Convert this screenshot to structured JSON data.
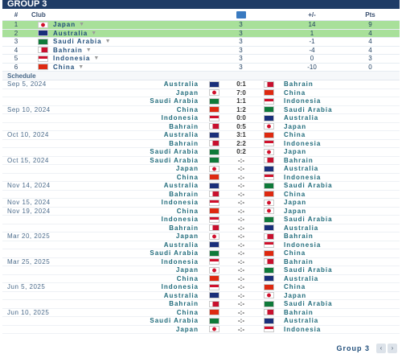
{
  "header": {
    "title": "GROUP 3"
  },
  "standings": {
    "columns": {
      "pos": "#",
      "club": "Club",
      "gd": "+/-",
      "pts": "Pts"
    },
    "rows": [
      {
        "pos": "1",
        "club": "Japan",
        "flag": "japan",
        "played": "3",
        "gd": "14",
        "pts": "9",
        "qualified": true
      },
      {
        "pos": "2",
        "club": "Australia",
        "flag": "australia",
        "played": "3",
        "gd": "1",
        "pts": "4",
        "qualified": true
      },
      {
        "pos": "3",
        "club": "Saudi Arabia",
        "flag": "saudi",
        "played": "3",
        "gd": "-1",
        "pts": "4",
        "qualified": false
      },
      {
        "pos": "4",
        "club": "Bahrain",
        "flag": "bahrain",
        "played": "3",
        "gd": "-4",
        "pts": "4",
        "qualified": false
      },
      {
        "pos": "5",
        "club": "Indonesia",
        "flag": "indonesia",
        "played": "3",
        "gd": "0",
        "pts": "3",
        "qualified": false
      },
      {
        "pos": "6",
        "club": "China",
        "flag": "china",
        "played": "3",
        "gd": "-10",
        "pts": "0",
        "qualified": false
      }
    ]
  },
  "schedule": {
    "title": "Schedule",
    "matches": [
      {
        "date": "Sep 5, 2024",
        "home": "Australia",
        "hflag": "australia",
        "score": "0:1",
        "away": "Bahrain",
        "aflag": "bahrain"
      },
      {
        "date": "",
        "home": "Japan",
        "hflag": "japan",
        "score": "7:0",
        "away": "China",
        "aflag": "china"
      },
      {
        "date": "",
        "home": "Saudi Arabia",
        "hflag": "saudi",
        "score": "1:1",
        "away": "Indonesia",
        "aflag": "indonesia"
      },
      {
        "date": "Sep 10, 2024",
        "home": "China",
        "hflag": "china",
        "score": "1:2",
        "away": "Saudi Arabia",
        "aflag": "saudi"
      },
      {
        "date": "",
        "home": "Indonesia",
        "hflag": "indonesia",
        "score": "0:0",
        "away": "Australia",
        "aflag": "australia"
      },
      {
        "date": "",
        "home": "Bahrain",
        "hflag": "bahrain",
        "score": "0:5",
        "away": "Japan",
        "aflag": "japan"
      },
      {
        "date": "Oct 10, 2024",
        "home": "Australia",
        "hflag": "australia",
        "score": "3:1",
        "away": "China",
        "aflag": "china"
      },
      {
        "date": "",
        "home": "Bahrain",
        "hflag": "bahrain",
        "score": "2:2",
        "away": "Indonesia",
        "aflag": "indonesia"
      },
      {
        "date": "",
        "home": "Saudi Arabia",
        "hflag": "saudi",
        "score": "0:2",
        "away": "Japan",
        "aflag": "japan"
      },
      {
        "date": "Oct 15, 2024",
        "home": "Saudi Arabia",
        "hflag": "saudi",
        "score": "-:-",
        "away": "Bahrain",
        "aflag": "bahrain"
      },
      {
        "date": "",
        "home": "Japan",
        "hflag": "japan",
        "score": "-:-",
        "away": "Australia",
        "aflag": "australia"
      },
      {
        "date": "",
        "home": "China",
        "hflag": "china",
        "score": "-:-",
        "away": "Indonesia",
        "aflag": "indonesia"
      },
      {
        "date": "Nov 14, 2024",
        "home": "Australia",
        "hflag": "australia",
        "score": "-:-",
        "away": "Saudi Arabia",
        "aflag": "saudi"
      },
      {
        "date": "",
        "home": "Bahrain",
        "hflag": "bahrain",
        "score": "-:-",
        "away": "China",
        "aflag": "china"
      },
      {
        "date": "Nov 15, 2024",
        "home": "Indonesia",
        "hflag": "indonesia",
        "score": "-:-",
        "away": "Japan",
        "aflag": "japan"
      },
      {
        "date": "Nov 19, 2024",
        "home": "China",
        "hflag": "china",
        "score": "-:-",
        "away": "Japan",
        "aflag": "japan"
      },
      {
        "date": "",
        "home": "Indonesia",
        "hflag": "indonesia",
        "score": "-:-",
        "away": "Saudi Arabia",
        "aflag": "saudi"
      },
      {
        "date": "",
        "home": "Bahrain",
        "hflag": "bahrain",
        "score": "-:-",
        "away": "Australia",
        "aflag": "australia"
      },
      {
        "date": "Mar 20, 2025",
        "home": "Japan",
        "hflag": "japan",
        "score": "-:-",
        "away": "Bahrain",
        "aflag": "bahrain"
      },
      {
        "date": "",
        "home": "Australia",
        "hflag": "australia",
        "score": "-:-",
        "away": "Indonesia",
        "aflag": "indonesia"
      },
      {
        "date": "",
        "home": "Saudi Arabia",
        "hflag": "saudi",
        "score": "-:-",
        "away": "China",
        "aflag": "china"
      },
      {
        "date": "Mar 25, 2025",
        "home": "Indonesia",
        "hflag": "indonesia",
        "score": "-:-",
        "away": "Bahrain",
        "aflag": "bahrain"
      },
      {
        "date": "",
        "home": "Japan",
        "hflag": "japan",
        "score": "-:-",
        "away": "Saudi Arabia",
        "aflag": "saudi"
      },
      {
        "date": "",
        "home": "China",
        "hflag": "china",
        "score": "-:-",
        "away": "Australia",
        "aflag": "australia"
      },
      {
        "date": "Jun 5, 2025",
        "home": "Indonesia",
        "hflag": "indonesia",
        "score": "-:-",
        "away": "China",
        "aflag": "china"
      },
      {
        "date": "",
        "home": "Australia",
        "hflag": "australia",
        "score": "-:-",
        "away": "Japan",
        "aflag": "japan"
      },
      {
        "date": "",
        "home": "Bahrain",
        "hflag": "bahrain",
        "score": "-:-",
        "away": "Saudi Arabia",
        "aflag": "saudi"
      },
      {
        "date": "Jun 10, 2025",
        "home": "China",
        "hflag": "china",
        "score": "-:-",
        "away": "Bahrain",
        "aflag": "bahrain"
      },
      {
        "date": "",
        "home": "Saudi Arabia",
        "hflag": "saudi",
        "score": "-:-",
        "away": "Australia",
        "aflag": "australia"
      },
      {
        "date": "",
        "home": "Japan",
        "hflag": "japan",
        "score": "-:-",
        "away": "Indonesia",
        "aflag": "indonesia"
      }
    ]
  },
  "footer": {
    "group_label": "Group 3",
    "prev_icon": "chevron-left-icon",
    "next_icon": "chevron-right-icon"
  },
  "colors": {
    "header_bg": "#1f3c66",
    "qualified_bg": "#a8e09a",
    "team_text": "#1f6a7a"
  }
}
